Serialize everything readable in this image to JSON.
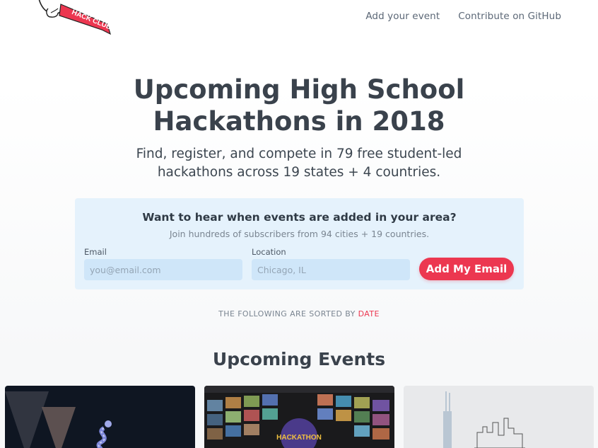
{
  "nav": {
    "logo_text": "HACK CLUB",
    "links": [
      "Add your event",
      "Contribute on GitHub"
    ]
  },
  "hero": {
    "title_line1": "Upcoming High School",
    "title_line2": "Hackathons in 2018",
    "subtitle_line1": "Find, register, and compete in 79 free student-led",
    "subtitle_line2": "hackathons across 19 states + 4 countries."
  },
  "signup": {
    "title": "Want to hear when events are added in your area?",
    "subtitle": "Join hundreds of subscribers from 94 cities + 19 countries.",
    "email_label": "Email",
    "email_placeholder": "you@email.com",
    "location_label": "Location",
    "location_placeholder": "Chicago, IL",
    "button_label": "Add My Email"
  },
  "sort": {
    "prefix": "THE FOLLOWING ARE SORTED BY ",
    "key": "DATE"
  },
  "events": {
    "heading": "Upcoming Events",
    "cards": [
      {
        "theme": "dark-triangles-snake"
      },
      {
        "theme": "tv-wall",
        "badge_text": "HACKATHON"
      },
      {
        "theme": "chicago-skyline"
      }
    ]
  },
  "colors": {
    "accent": "#ec3750",
    "signup_bg": "#e5f2fc",
    "input_bg": "#cfe6f9",
    "text_dark": "#3a424c"
  }
}
